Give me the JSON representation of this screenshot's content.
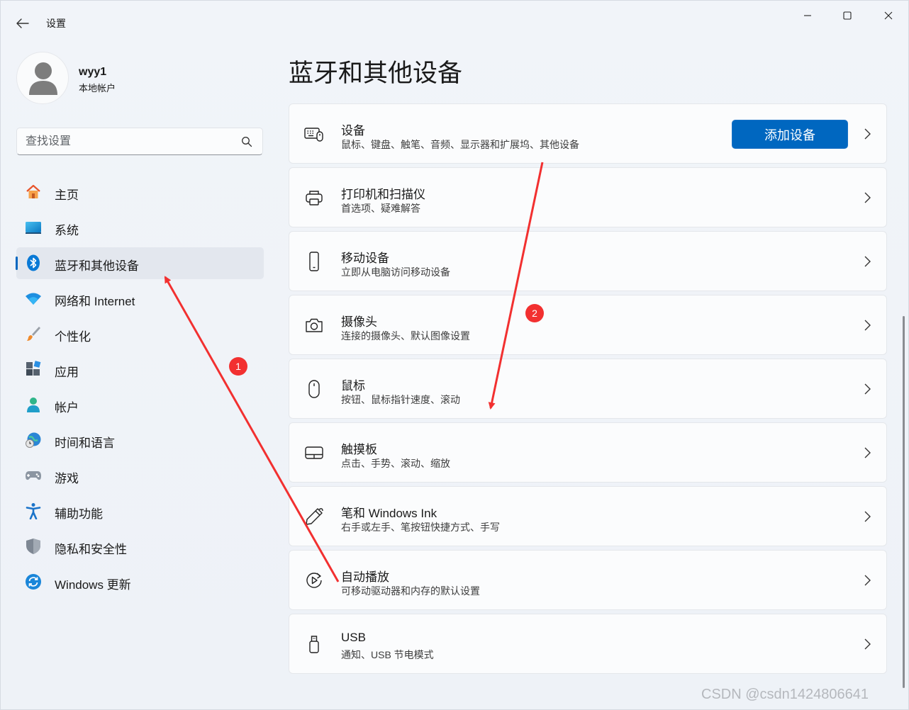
{
  "titlebar": {
    "app_title": "设置",
    "back_icon": "arrow-left-icon",
    "minimize_icon": "minimize-icon",
    "maximize_icon": "maximize-icon",
    "close_icon": "close-icon"
  },
  "user": {
    "name": "wyy1",
    "account_type": "本地帐户"
  },
  "search": {
    "placeholder": "查找设置",
    "value": ""
  },
  "sidebar": {
    "items": [
      {
        "label": "主页",
        "icon": "home-icon",
        "active": false
      },
      {
        "label": "系统",
        "icon": "system-display-icon",
        "active": false
      },
      {
        "label": "蓝牙和其他设备",
        "icon": "bluetooth-icon",
        "active": true
      },
      {
        "label": "网络和 Internet",
        "icon": "wifi-icon",
        "active": false
      },
      {
        "label": "个性化",
        "icon": "paint-brush-icon",
        "active": false
      },
      {
        "label": "应用",
        "icon": "apps-icon",
        "active": false
      },
      {
        "label": "帐户",
        "icon": "account-icon",
        "active": false
      },
      {
        "label": "时间和语言",
        "icon": "time-language-icon",
        "active": false
      },
      {
        "label": "游戏",
        "icon": "gamepad-icon",
        "active": false
      },
      {
        "label": "辅助功能",
        "icon": "accessibility-icon",
        "active": false
      },
      {
        "label": "隐私和安全性",
        "icon": "shield-icon",
        "active": false
      },
      {
        "label": "Windows 更新",
        "icon": "update-icon",
        "active": false
      }
    ]
  },
  "main": {
    "title": "蓝牙和其他设备",
    "add_device_label": "添加设备",
    "cards": [
      {
        "title": "设备",
        "desc": "鼠标、键盘、触笔、音频、显示器和扩展坞、其他设备",
        "icon": "devices-icon"
      },
      {
        "title": "打印机和扫描仪",
        "desc": "首选项、疑难解答",
        "icon": "printer-icon"
      },
      {
        "title": "移动设备",
        "desc": "立即从电脑访问移动设备",
        "icon": "phone-icon"
      },
      {
        "title": "摄像头",
        "desc": "连接的摄像头、默认图像设置",
        "icon": "camera-icon"
      },
      {
        "title": "鼠标",
        "desc": "按钮、鼠标指针速度、滚动",
        "icon": "mouse-icon"
      },
      {
        "title": "触摸板",
        "desc": "点击、手势、滚动、缩放",
        "icon": "touchpad-icon"
      },
      {
        "title": "笔和 Windows Ink",
        "desc": "右手或左手、笔按钮快捷方式、手写",
        "icon": "pen-icon"
      },
      {
        "title": "自动播放",
        "desc": "可移动驱动器和内存的默认设置",
        "icon": "autoplay-icon"
      },
      {
        "title": "USB",
        "desc": "通知、USB 节电模式",
        "icon": "usb-icon"
      }
    ]
  },
  "annotations": {
    "badge_1": "1",
    "badge_2": "2",
    "arrow_color": "#f23030"
  },
  "watermark": "CSDN @csdn1424806641",
  "colors": {
    "accent": "#0067c0",
    "background": "#eff3f8",
    "card": "#fbfcfd"
  }
}
